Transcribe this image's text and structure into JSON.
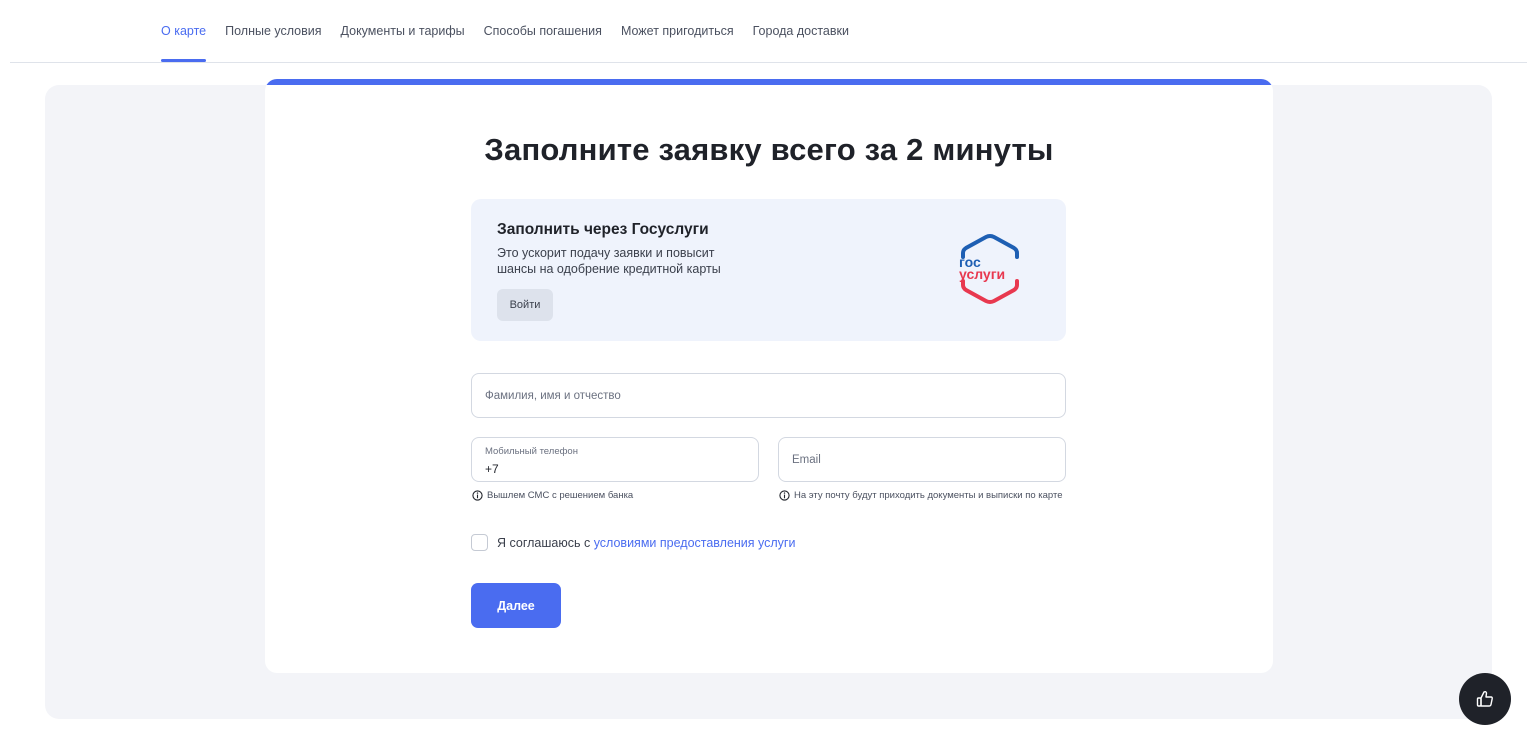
{
  "nav": {
    "items": [
      {
        "label": "О карте",
        "active": true
      },
      {
        "label": "Полные условия"
      },
      {
        "label": "Документы и тарифы"
      },
      {
        "label": "Способы погашения"
      },
      {
        "label": "Может пригодиться"
      },
      {
        "label": "Города доставки"
      }
    ]
  },
  "form": {
    "title": "Заполните заявку всего за 2 минуты",
    "gosuslugi": {
      "title": "Заполнить через Госуслуги",
      "description": "Это ускорит подачу заявки и повысит шансы на одобрение кредитной карты",
      "button_label": "Войти",
      "logo_line1": "гос",
      "logo_line2": "услуги"
    },
    "fio": {
      "placeholder": "Фамилия, имя и отчество",
      "value": ""
    },
    "phone": {
      "label": "Мобильный телефон",
      "value": "+7"
    },
    "email": {
      "placeholder": "Email",
      "value": ""
    },
    "phone_hint": "Вышлем СМС с решением банка",
    "email_hint": "На эту почту будут приходить документы и выписки по карте",
    "agree_prefix": "Я соглашаюсь с ",
    "agree_link": "условиями предоставления услуги",
    "agree_checked": false,
    "submit_label": "Далее"
  },
  "colors": {
    "accent": "#4a6cf0",
    "dark": "#1f2229",
    "gos_blue": "#1e5fb3",
    "gos_red": "#e8384f"
  },
  "icons": {
    "hint": "info-icon",
    "fab": "thumbs-up-icon"
  }
}
